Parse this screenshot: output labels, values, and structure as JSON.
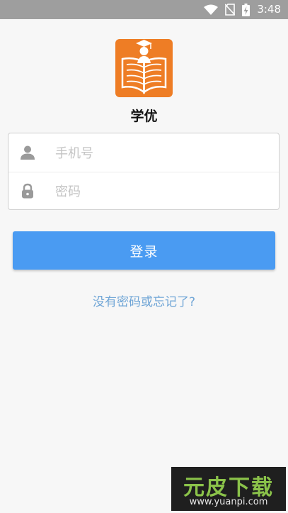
{
  "status_bar": {
    "time": "3:48"
  },
  "app": {
    "name": "学优"
  },
  "form": {
    "phone_placeholder": "手机号",
    "password_placeholder": "密码"
  },
  "actions": {
    "login_label": "登录",
    "forgot_label": "没有密码或忘记了?"
  },
  "watermark": {
    "title": "元皮下载",
    "url": "www.yuanpi.com"
  },
  "colors": {
    "status_bar": "#9e9e9e",
    "brand_orange": "#ee7d25",
    "primary_button": "#4a9bf2",
    "link": "#6fa5d6",
    "background": "#f7f7f7"
  }
}
